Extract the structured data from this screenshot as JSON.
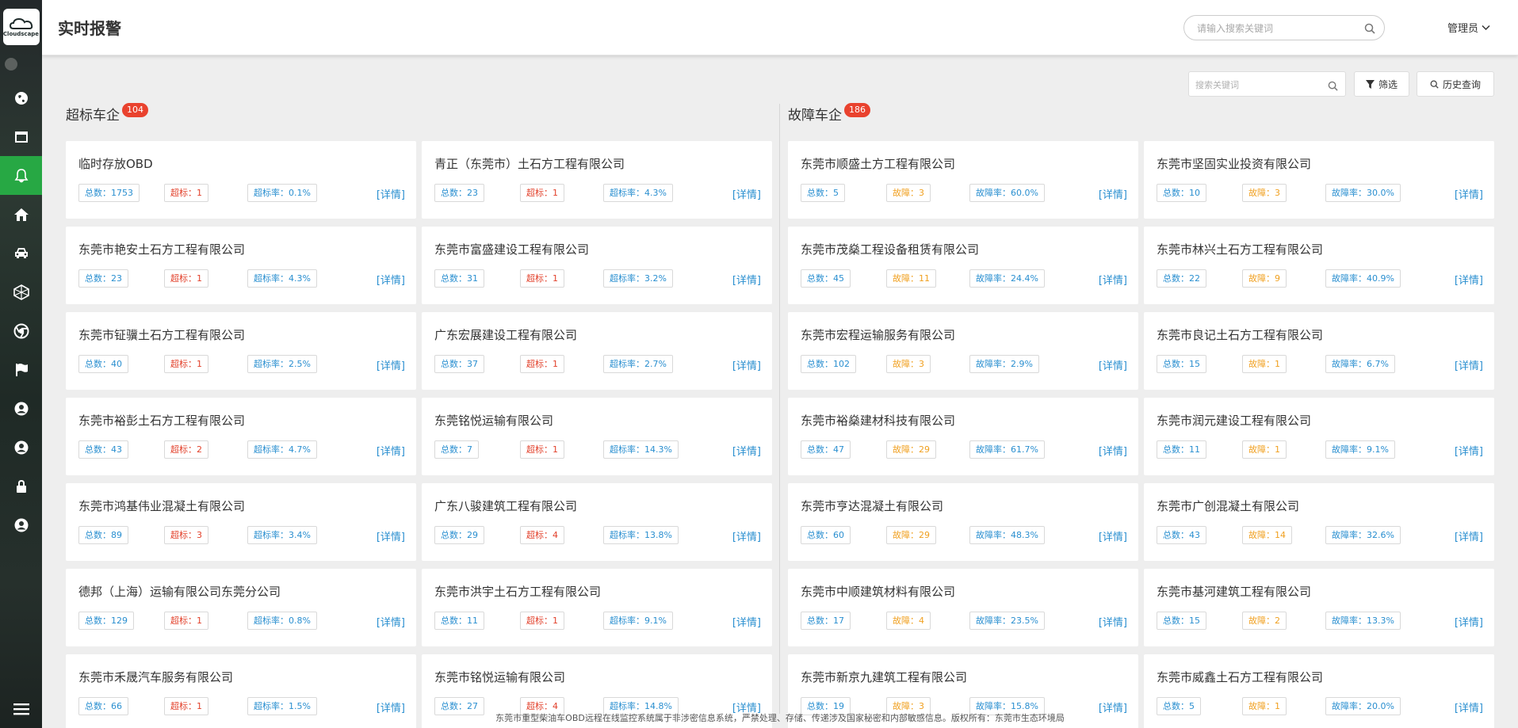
{
  "app": {
    "logo_text": "Cloudscape",
    "page_title": "实时报警"
  },
  "header": {
    "search_placeholder": "请输入搜索关键词",
    "user": "管理员"
  },
  "toolbar": {
    "search_placeholder": "搜索关键词",
    "filter_label": "筛选",
    "history_label": "历史查询"
  },
  "sidebar": {
    "items": [
      {
        "icon": "globe-icon"
      },
      {
        "icon": "window-icon"
      },
      {
        "icon": "bell-icon",
        "active": true
      },
      {
        "icon": "home-icon"
      },
      {
        "icon": "car-icon"
      },
      {
        "icon": "network-icon"
      },
      {
        "icon": "chrome-icon"
      },
      {
        "icon": "flag-icon"
      },
      {
        "icon": "user-icon"
      },
      {
        "icon": "user-icon"
      },
      {
        "icon": "lock-icon"
      },
      {
        "icon": "user-icon"
      }
    ]
  },
  "colors": {
    "accent": "#27a844",
    "blue": "#2a8fd0",
    "red": "#e2412b",
    "orange": "#f0a020",
    "badge": "#e9422e"
  },
  "left": {
    "title": "超标车企",
    "badge": "104",
    "total_label": "总数：",
    "metric_label": "超标：",
    "rate_label": "超标率：",
    "detail": "[详情]",
    "cards": [
      {
        "name": "临时存放OBD",
        "total": "1753",
        "metric": "1",
        "rate": "0.1%"
      },
      {
        "name": "青正（东莞市）土石方工程有限公司",
        "total": "23",
        "metric": "1",
        "rate": "4.3%"
      },
      {
        "name": "东莞市艳安土石方工程有限公司",
        "total": "23",
        "metric": "1",
        "rate": "4.3%"
      },
      {
        "name": "东莞市富盛建设工程有限公司",
        "total": "31",
        "metric": "1",
        "rate": "3.2%"
      },
      {
        "name": "东莞市钲骥土石方工程有限公司",
        "total": "40",
        "metric": "1",
        "rate": "2.5%"
      },
      {
        "name": "广东宏展建设工程有限公司",
        "total": "37",
        "metric": "1",
        "rate": "2.7%"
      },
      {
        "name": "东莞市裕彭土石方工程有限公司",
        "total": "43",
        "metric": "2",
        "rate": "4.7%"
      },
      {
        "name": "东莞铭悦运输有限公司",
        "total": "7",
        "metric": "1",
        "rate": "14.3%"
      },
      {
        "name": "东莞市鸿基伟业混凝土有限公司",
        "total": "89",
        "metric": "3",
        "rate": "3.4%"
      },
      {
        "name": "广东八骏建筑工程有限公司",
        "total": "29",
        "metric": "4",
        "rate": "13.8%"
      },
      {
        "name": "德邦（上海）运输有限公司东莞分公司",
        "total": "129",
        "metric": "1",
        "rate": "0.8%"
      },
      {
        "name": "东莞市洪宇土石方工程有限公司",
        "total": "11",
        "metric": "1",
        "rate": "9.1%"
      },
      {
        "name": "东莞市禾晟汽车服务有限公司",
        "total": "66",
        "metric": "1",
        "rate": "1.5%"
      },
      {
        "name": "东莞市铭悦运输有限公司",
        "total": "27",
        "metric": "4",
        "rate": "14.8%"
      }
    ]
  },
  "right": {
    "title": "故障车企",
    "badge": "186",
    "total_label": "总数：",
    "metric_label": "故障：",
    "rate_label": "故障率：",
    "detail": "[详情]",
    "cards": [
      {
        "name": "东莞市顺盛土方工程有限公司",
        "total": "5",
        "metric": "3",
        "rate": "60.0%"
      },
      {
        "name": "东莞市坚固实业投资有限公司",
        "total": "10",
        "metric": "3",
        "rate": "30.0%"
      },
      {
        "name": "东莞市茂燊工程设备租赁有限公司",
        "total": "45",
        "metric": "11",
        "rate": "24.4%"
      },
      {
        "name": "东莞市林兴土石方工程有限公司",
        "total": "22",
        "metric": "9",
        "rate": "40.9%"
      },
      {
        "name": "东莞市宏程运输服务有限公司",
        "total": "102",
        "metric": "3",
        "rate": "2.9%"
      },
      {
        "name": "东莞市良记土石方工程有限公司",
        "total": "15",
        "metric": "1",
        "rate": "6.7%"
      },
      {
        "name": "东莞市裕燊建材科技有限公司",
        "total": "47",
        "metric": "29",
        "rate": "61.7%"
      },
      {
        "name": "东莞市润元建设工程有限公司",
        "total": "11",
        "metric": "1",
        "rate": "9.1%"
      },
      {
        "name": "东莞市亨达混凝土有限公司",
        "total": "60",
        "metric": "29",
        "rate": "48.3%"
      },
      {
        "name": "东莞市广创混凝土有限公司",
        "total": "43",
        "metric": "14",
        "rate": "32.6%"
      },
      {
        "name": "东莞市中顺建筑材料有限公司",
        "total": "17",
        "metric": "4",
        "rate": "23.5%"
      },
      {
        "name": "东莞市基河建筑工程有限公司",
        "total": "15",
        "metric": "2",
        "rate": "13.3%"
      },
      {
        "name": "东莞市新京九建筑工程有限公司",
        "total": "19",
        "metric": "3",
        "rate": "15.8%"
      },
      {
        "name": "东莞市威鑫土石方工程有限公司",
        "total": "5",
        "metric": "1",
        "rate": "20.0%"
      }
    ]
  },
  "footer": {
    "text": "东莞市重型柴油车OBD远程在线监控系统属于非涉密信息系统，严禁处理、存储、传递涉及国家秘密和内部敏感信息。版权所有：东莞市生态环境局"
  }
}
